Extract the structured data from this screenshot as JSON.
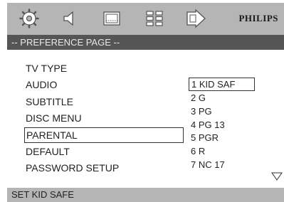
{
  "toolbar": {
    "icons": [
      "settings-icon",
      "speaker-icon",
      "display-icon",
      "video-grid-icon",
      "preferences-arrow-icon"
    ],
    "brand": "PHILIPS"
  },
  "page_title": "-- PREFERENCE PAGE --",
  "menu": {
    "items": [
      "TV TYPE",
      "AUDIO",
      "SUBTITLE",
      "DISC MENU",
      "PARENTAL",
      "DEFAULT",
      "PASSWORD SETUP"
    ],
    "selected": "PARENTAL"
  },
  "options": {
    "items": [
      "1 KID SAF",
      "2 G",
      "3 PG",
      "4 PG 13",
      "5 PGR",
      "6 R",
      "7 NC 17"
    ],
    "highlighted": "1 KID SAF"
  },
  "status": "SET KID SAFE",
  "colors": {
    "topbar": "#b5b5b5",
    "pagebar": "#555555",
    "statusbar": "#b5b5b5",
    "background": "#ffffff"
  }
}
